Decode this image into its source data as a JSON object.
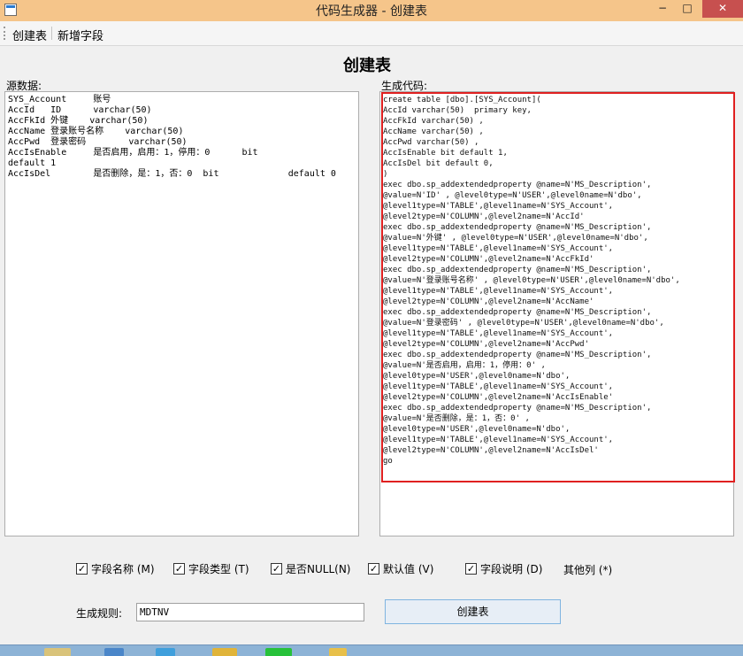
{
  "window": {
    "title": "代码生成器 - 创建表",
    "minimize": "−",
    "maximize": "□",
    "close": "✕"
  },
  "menu": {
    "items": [
      "创建表",
      "新增字段"
    ]
  },
  "page_title": "创建表",
  "source_label": "源数据:",
  "generated_label": "生成代码:",
  "source_text": "SYS_Account     账号\nAccId   ID      varchar(50)\nAccFkId 外键    varchar(50)\nAccName 登录账号名称    varchar(50)\nAccPwd  登录密码        varchar(50)\nAccIsEnable     是否启用，启用：1，停用：0      bit\ndefault 1\nAccIsDel        是否删除，是：1，否：0  bit             default 0",
  "generated_code": "create table [dbo].[SYS_Account](\nAccId varchar(50)  primary key,\nAccFkId varchar(50) ,\nAccName varchar(50) ,\nAccPwd varchar(50) ,\nAccIsEnable bit default 1,\nAccIsDel bit default 0,\n)\nexec dbo.sp_addextendedproperty @name=N'MS_Description',\n@value=N'ID' , @level0type=N'USER',@level0name=N'dbo',\n@level1type=N'TABLE',@level1name=N'SYS_Account',\n@level2type=N'COLUMN',@level2name=N'AccId'\nexec dbo.sp_addextendedproperty @name=N'MS_Description',\n@value=N'外键' , @level0type=N'USER',@level0name=N'dbo',\n@level1type=N'TABLE',@level1name=N'SYS_Account',\n@level2type=N'COLUMN',@level2name=N'AccFkId'\nexec dbo.sp_addextendedproperty @name=N'MS_Description',\n@value=N'登录账号名称' , @level0type=N'USER',@level0name=N'dbo',\n@level1type=N'TABLE',@level1name=N'SYS_Account',\n@level2type=N'COLUMN',@level2name=N'AccName'\nexec dbo.sp_addextendedproperty @name=N'MS_Description',\n@value=N'登录密码' , @level0type=N'USER',@level0name=N'dbo',\n@level1type=N'TABLE',@level1name=N'SYS_Account',\n@level2type=N'COLUMN',@level2name=N'AccPwd'\nexec dbo.sp_addextendedproperty @name=N'MS_Description',\n@value=N'是否启用，启用：1，停用：0' ,\n@level0type=N'USER',@level0name=N'dbo',\n@level1type=N'TABLE',@level1name=N'SYS_Account',\n@level2type=N'COLUMN',@level2name=N'AccIsEnable'\nexec dbo.sp_addextendedproperty @name=N'MS_Description',\n@value=N'是否删除，是：1，否：0' ,\n@level0type=N'USER',@level0name=N'dbo',\n@level1type=N'TABLE',@level1name=N'SYS_Account',\n@level2type=N'COLUMN',@level2name=N'AccIsDel'\ngo",
  "options": [
    {
      "label": "字段名称 (M)",
      "checked": true
    },
    {
      "label": "字段类型 (T)",
      "checked": true
    },
    {
      "label": "是否NULL(N)",
      "checked": true
    },
    {
      "label": "默认值 (V)",
      "checked": true
    },
    {
      "label": "字段说明 (D)",
      "checked": true
    }
  ],
  "other_columns": "其他列 (*)",
  "rule_label": "生成规则:",
  "rule_value": "MDTNV",
  "create_button": "创建表"
}
